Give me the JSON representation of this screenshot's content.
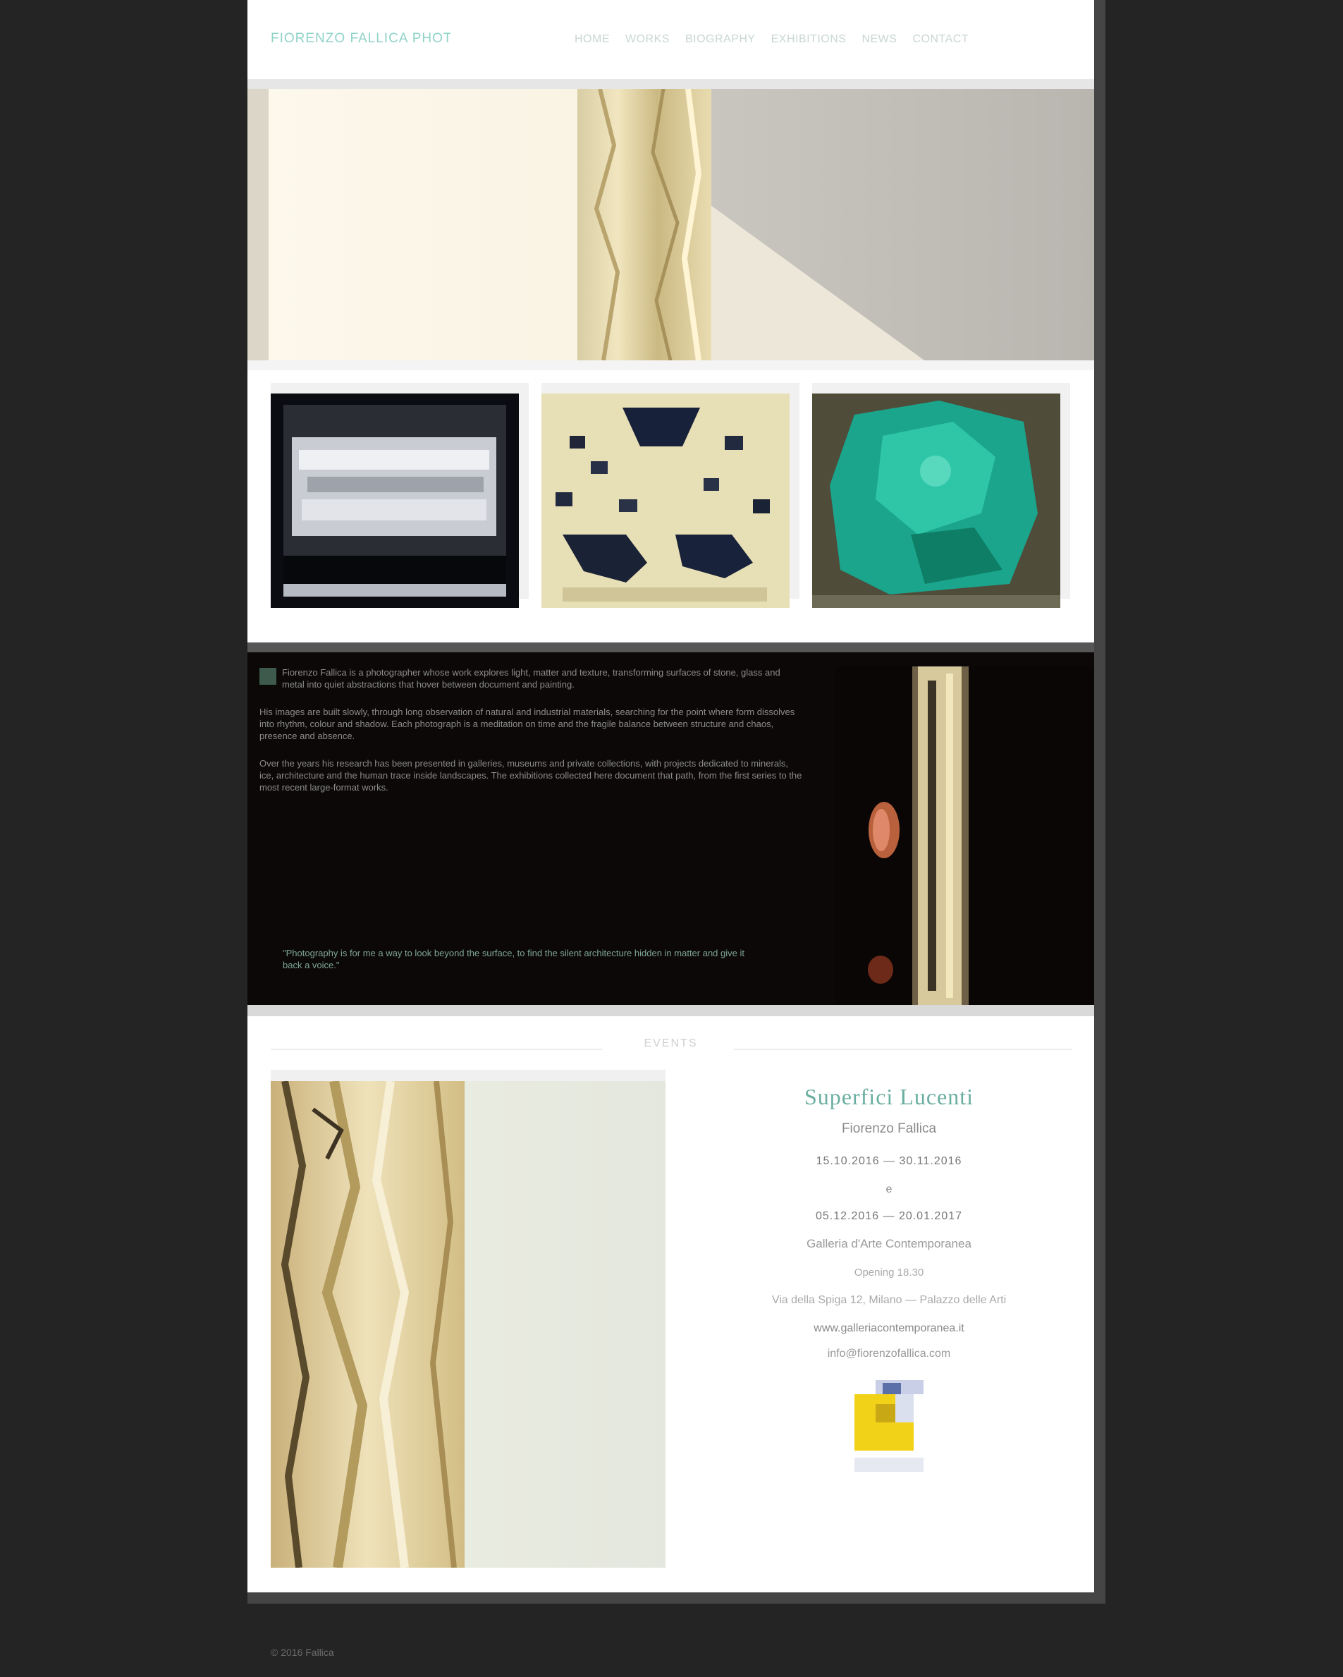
{
  "header": {
    "logo": "FIORENZO FALLICA PHOTOGRAPHY",
    "nav": [
      "HOME",
      "WORKS",
      "BIOGRAPHY",
      "EXHIBITIONS",
      "NEWS",
      "CONTACT"
    ]
  },
  "about": {
    "paragraphs": [
      "Fiorenzo Fallica is a photographer whose work explores light, matter and texture, transforming surfaces of stone, glass and metal into quiet abstractions that hover between document and painting.",
      "His images are built slowly, through long observation of natural and industrial materials, searching for the point where form dissolves into rhythm, colour and shadow. Each photograph is a meditation on time and the fragile balance between structure and chaos, presence and absence.",
      "Over the years his research has been presented in galleries, museums and private collections, with projects dedicated to minerals, ice, architecture and the human trace inside landscapes. The exhibitions collected here document that path, from the first series to the most recent large-format works."
    ],
    "quote": "\"Photography is for me a way to look beyond the surface, to find the silent architecture hidden in matter and give it back a voice.\""
  },
  "lower": {
    "section_title": "EVENTS",
    "exhibition": {
      "title": "Superfici Lucenti",
      "subtitle": "Fiorenzo Fallica",
      "dates_line1": "15.10.2016 — 30.11.2016",
      "connector": "e",
      "dates_line2": "05.12.2016 — 20.01.2017",
      "gallery": "Galleria d'Arte Contemporanea",
      "small_line": "Opening 18.30",
      "address": "Via della Spiga 12, Milano — Palazzo delle Arti",
      "link1": "www.galleriacontemporanea.it",
      "link2": "info@fiorenzofallica.com"
    }
  },
  "footer": {
    "text": "© 2016 Fallica"
  }
}
